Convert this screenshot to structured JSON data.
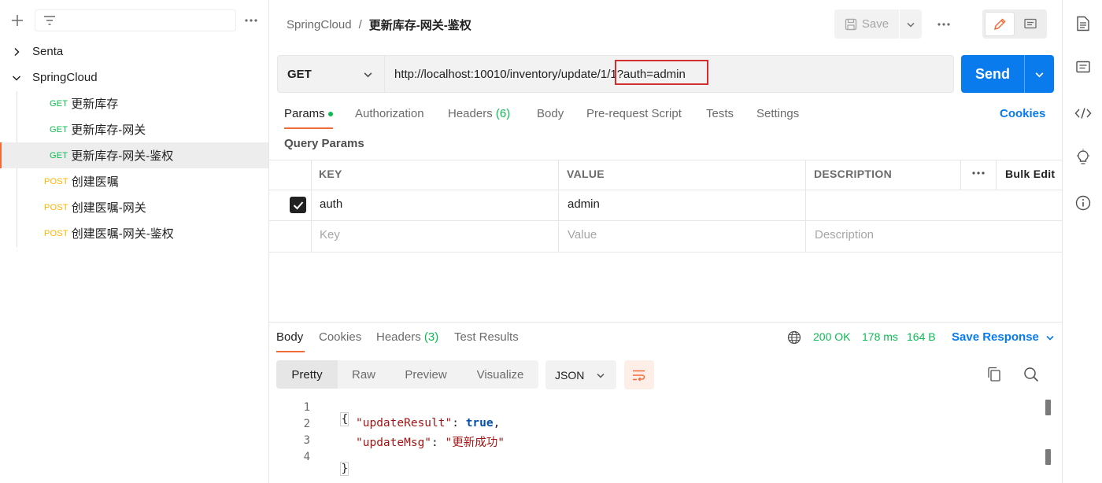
{
  "sidebar": {
    "collections": [
      {
        "name": "Senta",
        "expanded": false
      },
      {
        "name": "SpringCloud",
        "expanded": true
      }
    ],
    "requests": [
      {
        "method": "GET",
        "name": "更新库存"
      },
      {
        "method": "GET",
        "name": "更新库存-网关"
      },
      {
        "method": "GET",
        "name": "更新库存-网关-鉴权",
        "active": true
      },
      {
        "method": "POST",
        "name": "创建医嘱"
      },
      {
        "method": "POST",
        "name": "创建医嘱-网关"
      },
      {
        "method": "POST",
        "name": "创建医嘱-网关-鉴权"
      }
    ]
  },
  "header": {
    "breadcrumb_collection": "SpringCloud",
    "breadcrumb_sep": "/",
    "breadcrumb_request": "更新库存-网关-鉴权",
    "save_label": "Save"
  },
  "request": {
    "method": "GET",
    "url_base": "http://localhost:10010/inventory/update/1/",
    "url_query": "1?auth=admin",
    "send_label": "Send",
    "tabs": {
      "params": "Params",
      "authorization": "Authorization",
      "headers": "Headers",
      "headers_count": "(6)",
      "body": "Body",
      "prerequest": "Pre-request Script",
      "tests": "Tests",
      "settings": "Settings"
    },
    "cookies_label": "Cookies",
    "query_params_title": "Query Params",
    "table": {
      "col_key": "KEY",
      "col_value": "VALUE",
      "col_description": "DESCRIPTION",
      "bulk_edit": "Bulk Edit",
      "row_key": "auth",
      "row_value": "admin",
      "ph_key": "Key",
      "ph_value": "Value",
      "ph_description": "Description"
    }
  },
  "response": {
    "tabs": {
      "body": "Body",
      "cookies": "Cookies",
      "headers": "Headers",
      "headers_count": "(3)",
      "test_results": "Test Results"
    },
    "status": "200 OK",
    "time": "178 ms",
    "size": "164 B",
    "save_response": "Save Response",
    "views": {
      "pretty": "Pretty",
      "raw": "Raw",
      "preview": "Preview",
      "visualize": "Visualize"
    },
    "format": "JSON",
    "code": {
      "line_numbers": [
        "1",
        "2",
        "3",
        "4"
      ],
      "open_brace": "{",
      "key1": "\"updateResult\"",
      "val1": "true",
      "key2": "\"updateMsg\"",
      "val2": "\"更新成功\"",
      "close_brace": "}"
    }
  },
  "colors": {
    "accent": "#f26b3a",
    "send_blue": "#097bed",
    "get_green": "#0cbb52",
    "post_yellow": "#ffb400",
    "highlight_red": "#d32f2f"
  }
}
